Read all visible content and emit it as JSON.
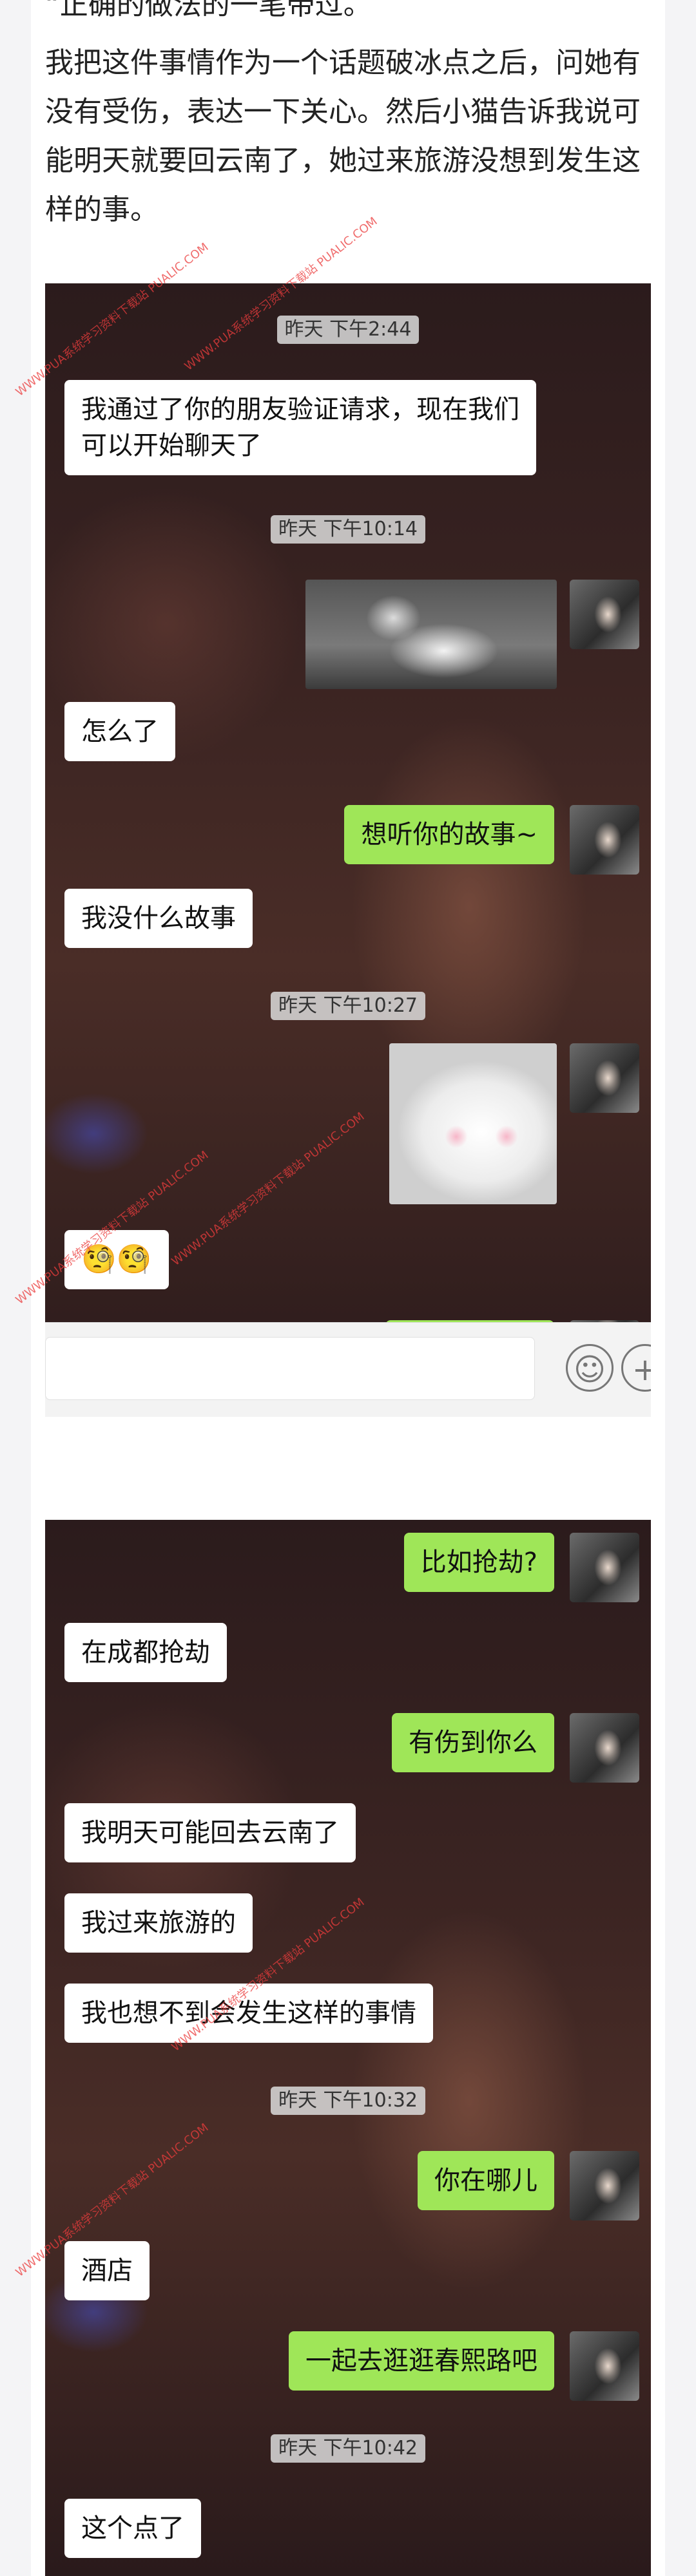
{
  "article": {
    "line0": "“正确的做法的一笔带过。",
    "para1": "我把这件事情作为一个话题破冰点之后，问她有没有受伤，表达一下关心。然后小猫告诉我说可能明天就要回云南了，她过来旅游没想到发生这样的事。"
  },
  "screenshot1": {
    "ts1": "昨天 下午2:44",
    "msg_verify": "我通过了你的朋友验证请求，现在我们可以开始聊天了",
    "ts2": "昨天 下午10:14",
    "msg_what": "怎么了",
    "msg_story": "想听你的故事~",
    "msg_nostory": "我没什么故事",
    "ts3": "昨天 下午10:27",
    "msg_emoji": "🧐🧐"
  },
  "screenshot2": {
    "msg_rob": "比如抢劫?",
    "msg_chengdu": "在成都抢劫",
    "msg_hurt": "有伤到你么",
    "msg_yunnan": "我明天可能回去云南了",
    "msg_travel": "我过来旅游的",
    "msg_unexpected": "我也想不到会发生这样的事情",
    "ts4": "昨天 下午10:32",
    "msg_where": "你在哪儿",
    "msg_hotel": "酒店",
    "msg_walk": "一起去逛逛春熙路吧",
    "ts5": "昨天 下午10:42",
    "msg_late": "这个点了"
  },
  "watermark": {
    "text": "WWW.PUA系统学习资料下载站 PUALIC.COM"
  },
  "icons": {
    "emoji_button": "smile-icon",
    "plus_button": "plus-icon"
  },
  "colors": {
    "outgoing_bubble": "#9fe658",
    "incoming_bubble": "#ffffff",
    "timestamp_bg": "#dcdcdc",
    "watermark": "#eb3c3c"
  }
}
